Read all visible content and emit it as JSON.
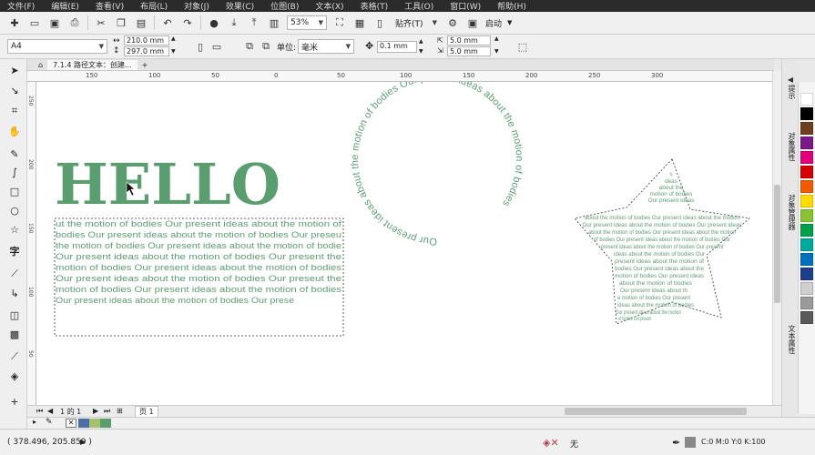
{
  "menu": {
    "items": [
      "文件(F)",
      "编辑(E)",
      "查看(V)",
      "布局(L)",
      "对象(J)",
      "效果(C)",
      "位图(B)",
      "文本(X)",
      "表格(T)",
      "工具(O)",
      "窗口(W)",
      "帮助(H)"
    ]
  },
  "toolbar": {
    "zoom": "53%",
    "paste_label": "贴齐(T)",
    "launch_label": "启动"
  },
  "property_bar": {
    "page_size": "A4",
    "width": "210.0 mm",
    "height": "297.0 mm",
    "units_label": "单位:",
    "units": "毫米",
    "nudge": "0.1 mm",
    "dup_x": "5.0 mm",
    "dup_y": "5.0 mm"
  },
  "document": {
    "tab_title": "7.1.4 路径文本：创建..."
  },
  "ruler": {
    "h_ticks": [
      "150",
      "100",
      "50",
      "0",
      "50",
      "100",
      "150",
      "200",
      "250",
      "300"
    ],
    "v_ticks": [
      "250",
      "200",
      "150",
      "100",
      "50"
    ]
  },
  "canvas": {
    "hello_text": "HELLO",
    "para_lines": [
      "ut the motion of bodies Our present ideas about the motion of",
      "bodies Our present ideas about the motion of bodies Our preseu",
      "the motion of bodies Our present ideas about the motion of bodie",
      "Our present ideas about the motion of bodies Our present the",
      "motion of bodies Our present ideas about the motion of bodies",
      "Our present ideas about the motion of bodies Our preseut the",
      "motion of bodies Our present ideas about the motion of bodies",
      "Our present ideas about the motion of bodies Our prese"
    ],
    "circle_text": "Our present ideas about the motion of bodies Our present ideas about the motion of bodies",
    "star_lines": [
      "s",
      "deas",
      "about the",
      "motion of bodies",
      "Our present ideas",
      "about the motion of bodies Our present ideas about the motion",
      "Our present ideas about the motion of bodies Our present ideas",
      "about the motion of bodies Our present ideas about the motion",
      "of bodies Our present ideas about the motion of bodies Our",
      "present ideas about the motion of bodies Our present",
      "ideas about the motion of bodies Our",
      "present ideas about the motion of",
      "bodies Our present ideas about the",
      "motion of bodies Our present ideas",
      "about the motion of bodies",
      "Our present ideas about th",
      "e motion of bodies Our present",
      "ideas about the motion of bodies",
      "Our present ideas about the motion",
      "of bodies Our presen"
    ]
  },
  "dockers": {
    "tabs": [
      "提示",
      "对象属性",
      "对象管理器",
      "文本属性"
    ]
  },
  "page_nav": {
    "page_of": "1 的 1",
    "page_tab": "页 1"
  },
  "status": {
    "coords": "( 378.496, 205.859 )",
    "fill_label": "无",
    "outline_info": "C:0 M:0 Y:0 K:100"
  },
  "colors": {
    "text_green": "#5a9e6f",
    "palette": [
      "#ffffff",
      "#000000",
      "#6e3f1f",
      "#7a1a8a",
      "#e3007b",
      "#d60000",
      "#f05a00",
      "#ffdd00",
      "#89c234",
      "#00a14b",
      "#00a99d",
      "#0072bc",
      "#1b3f8b",
      "#cfcfcf",
      "#9a9a9a",
      "#5a5a5a"
    ],
    "doc_palette": [
      "#4c6ea4",
      "#a5c070",
      "#5a9e6f"
    ]
  }
}
